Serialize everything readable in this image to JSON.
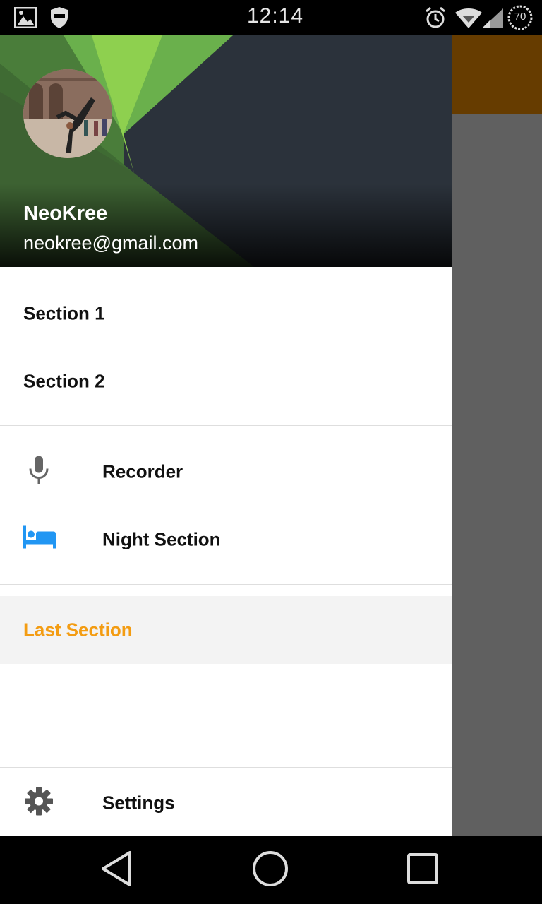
{
  "status_bar": {
    "time": "12:14",
    "battery_level": "70",
    "icons": [
      "image-icon",
      "shield-icon",
      "alarm-icon",
      "wifi-icon",
      "signal-icon",
      "battery-icon"
    ]
  },
  "drawer": {
    "header": {
      "name": "NeoKree",
      "email": "neokree@gmail.com"
    },
    "sections": [
      {
        "label": "Section 1"
      },
      {
        "label": "Section 2"
      }
    ],
    "icon_sections": [
      {
        "label": "Recorder",
        "icon": "microphone-icon"
      },
      {
        "label": "Night Section",
        "icon": "bed-icon"
      }
    ],
    "selected_section": {
      "label": "Last Section"
    },
    "bottom_section": {
      "label": "Settings",
      "icon": "gear-icon"
    }
  },
  "colors": {
    "accent": "#f39c12",
    "bed_icon": "#2196f3",
    "background_toolbar": "#663c00",
    "scrim": "#606060"
  },
  "nav_bar": {
    "buttons": [
      "back-icon",
      "home-icon",
      "recents-icon"
    ]
  }
}
